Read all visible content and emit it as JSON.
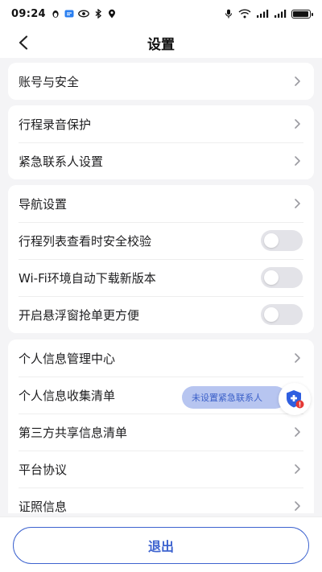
{
  "status_bar": {
    "time": "09:24",
    "left_icons": [
      "penguin-icon",
      "message-icon",
      "eye-icon",
      "bluetooth-icon",
      "location-icon"
    ],
    "right_icons": [
      "mic-icon",
      "wifi-icon",
      "signal-icon",
      "signal-icon",
      "battery-icon"
    ],
    "battery_level": 0.95
  },
  "header": {
    "title": "设置"
  },
  "sections": {
    "account": {
      "items": [
        {
          "label": "账号与安全"
        }
      ]
    },
    "trip": {
      "items": [
        {
          "label": "行程录音保护"
        },
        {
          "label": "紧急联系人设置"
        }
      ]
    },
    "settings": {
      "items": [
        {
          "label": "导航设置"
        },
        {
          "label": "行程列表查看时安全校验",
          "toggle": false
        },
        {
          "label": "Wi-Fi环境自动下载新版本",
          "toggle": false
        },
        {
          "label": "开启悬浮窗抢单更方便",
          "toggle": false
        }
      ]
    },
    "info": {
      "items": [
        {
          "label": "个人信息管理中心"
        },
        {
          "label": "个人信息收集清单"
        },
        {
          "label": "第三方共享信息清单"
        },
        {
          "label": "平台协议"
        },
        {
          "label": "证照信息"
        }
      ]
    }
  },
  "floating": {
    "tip": "未设置紧急联系人"
  },
  "footer": {
    "logout_label": "退出"
  },
  "colors": {
    "accent": "#3d63cf",
    "background": "#f4f4f6",
    "toggle_off": "#e3e3e8",
    "tip_bg": "#b7c5f0"
  }
}
